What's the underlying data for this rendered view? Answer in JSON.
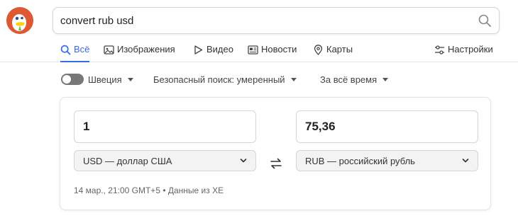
{
  "logo": {
    "icon": "duckduckgo-logo",
    "brand_color": "#de5833"
  },
  "search": {
    "value": "convert rub usd",
    "icon": "search-icon"
  },
  "nav": {
    "accent": "#3969ef",
    "tabs": [
      {
        "label": "Всё",
        "icon": "search-icon",
        "active": true
      },
      {
        "label": "Изображения",
        "icon": "image-icon"
      },
      {
        "label": "Видео",
        "icon": "play-icon"
      },
      {
        "label": "Новости",
        "icon": "newspaper-icon"
      },
      {
        "label": "Карты",
        "icon": "map-pin-icon"
      }
    ],
    "settings_label": "Настройки"
  },
  "filters": {
    "region": "Швеция",
    "region_toggle_on": false,
    "safe_search": "Безопасный поиск: умеренный",
    "time": "За всё время"
  },
  "converter": {
    "from_amount": "1",
    "to_amount": "75,36",
    "from_currency": "USD — доллар США",
    "to_currency": "RUB — российский рубль",
    "meta": "14 мар., 21:00 GMT+5 • Данные из XE"
  }
}
